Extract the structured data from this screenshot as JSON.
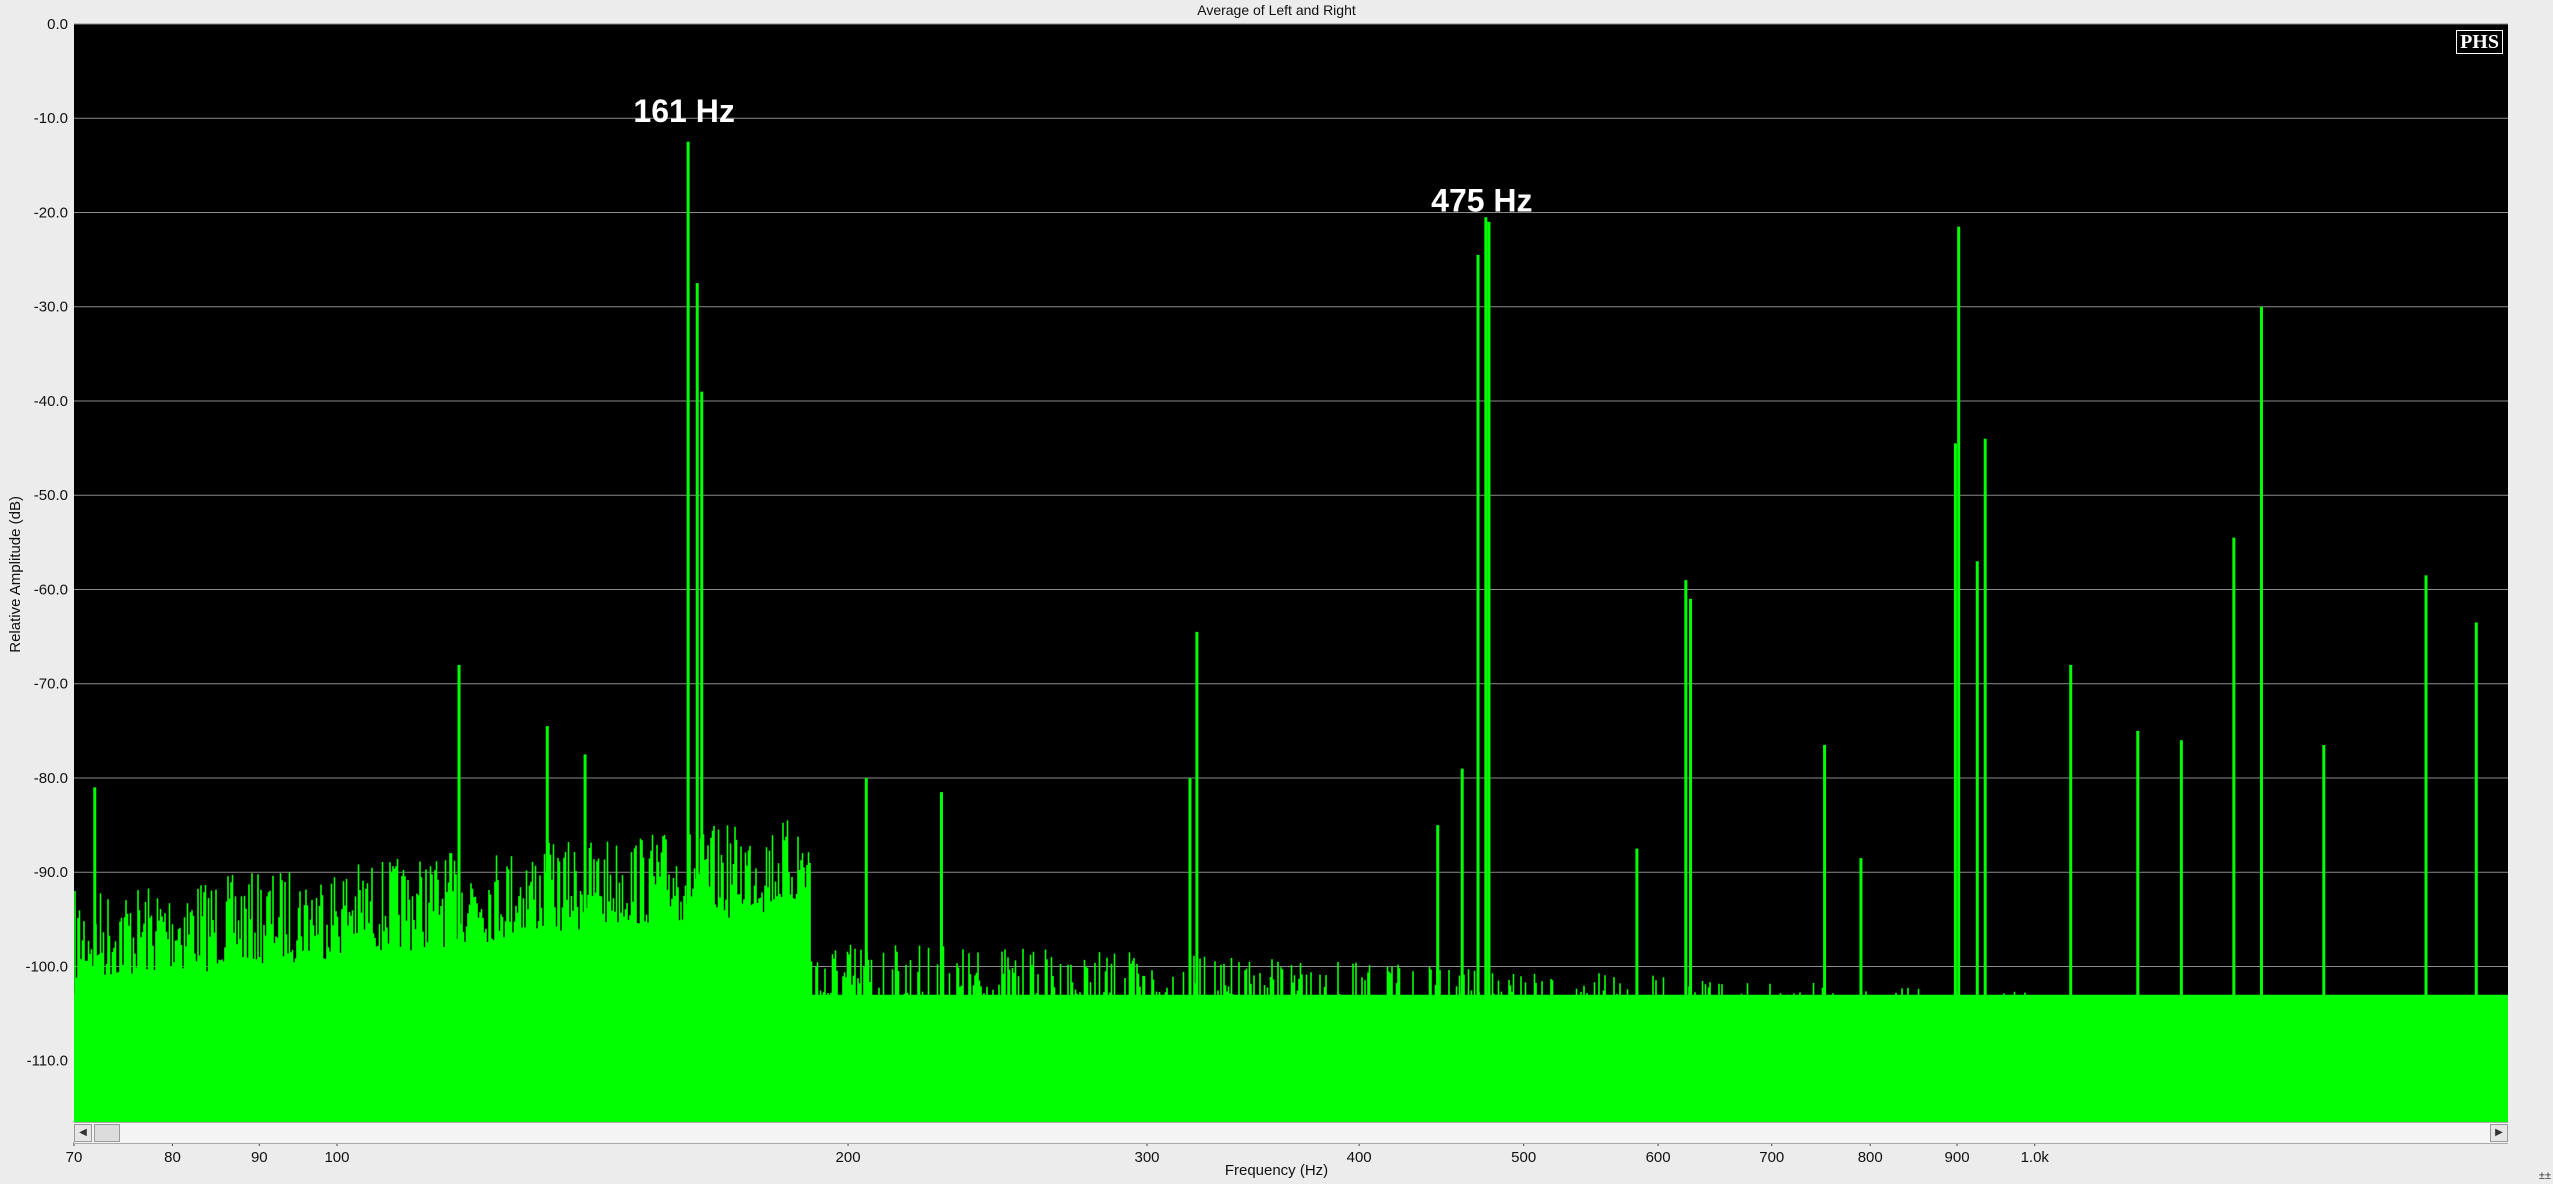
{
  "chart_data": {
    "type": "line",
    "title": "Average of Left and Right",
    "xlabel": "Frequency (Hz)",
    "ylabel": "Relative Amplitude (dB)",
    "x_scale": "log",
    "xlim": [
      70,
      1900
    ],
    "ylim": [
      -116.5,
      0
    ],
    "grid": true,
    "background": "#000000",
    "series_color": "#00ff00",
    "x_ticks": [
      "70",
      "80",
      "90",
      "100",
      "200",
      "300",
      "400",
      "500",
      "600",
      "700",
      "800",
      "900",
      "1.0k"
    ],
    "x_tick_values": [
      70,
      80,
      90,
      100,
      200,
      300,
      400,
      500,
      600,
      700,
      800,
      900,
      1000
    ],
    "y_ticks": [
      "0.0",
      "-10.0",
      "-20.0",
      "-30.0",
      "-40.0",
      "-50.0",
      "-60.0",
      "-70.0",
      "-80.0",
      "-90.0",
      "-100.0",
      "-110.0"
    ],
    "y_tick_values": [
      0,
      -10,
      -20,
      -30,
      -40,
      -50,
      -60,
      -70,
      -80,
      -90,
      -100,
      -110
    ],
    "annotations": [
      {
        "text": "161 Hz",
        "x": 161,
        "y": -8.5
      },
      {
        "text": "475 Hz",
        "x": 475,
        "y": -18
      }
    ],
    "peaks": [
      {
        "x": 72,
        "y": -81
      },
      {
        "x": 118,
        "y": -68
      },
      {
        "x": 133,
        "y": -74.5
      },
      {
        "x": 140,
        "y": -77.5
      },
      {
        "x": 161,
        "y": -12.5
      },
      {
        "x": 163,
        "y": -27.5
      },
      {
        "x": 164,
        "y": -39
      },
      {
        "x": 205,
        "y": -80
      },
      {
        "x": 227,
        "y": -81.5
      },
      {
        "x": 318,
        "y": -80
      },
      {
        "x": 321,
        "y": -64.5
      },
      {
        "x": 445,
        "y": -85
      },
      {
        "x": 460,
        "y": -79
      },
      {
        "x": 470,
        "y": -24.5
      },
      {
        "x": 475,
        "y": -20.5
      },
      {
        "x": 477,
        "y": -21
      },
      {
        "x": 583,
        "y": -87.5
      },
      {
        "x": 623,
        "y": -59
      },
      {
        "x": 627,
        "y": -61
      },
      {
        "x": 752,
        "y": -76.5
      },
      {
        "x": 790,
        "y": -88.5
      },
      {
        "x": 898,
        "y": -44.5
      },
      {
        "x": 902,
        "y": -21.5
      },
      {
        "x": 925,
        "y": -57
      },
      {
        "x": 935,
        "y": -44
      },
      {
        "x": 1050,
        "y": -68
      },
      {
        "x": 1150,
        "y": -75
      },
      {
        "x": 1220,
        "y": -76
      },
      {
        "x": 1310,
        "y": -54.5
      },
      {
        "x": 1360,
        "y": -30
      },
      {
        "x": 1480,
        "y": -76.5
      },
      {
        "x": 1700,
        "y": -58.5
      },
      {
        "x": 1820,
        "y": -63.5
      }
    ]
  },
  "logo": "PHS",
  "scrollbar": {
    "left_icon": "arrow-left-icon",
    "right_icon": "arrow-right-icon"
  }
}
